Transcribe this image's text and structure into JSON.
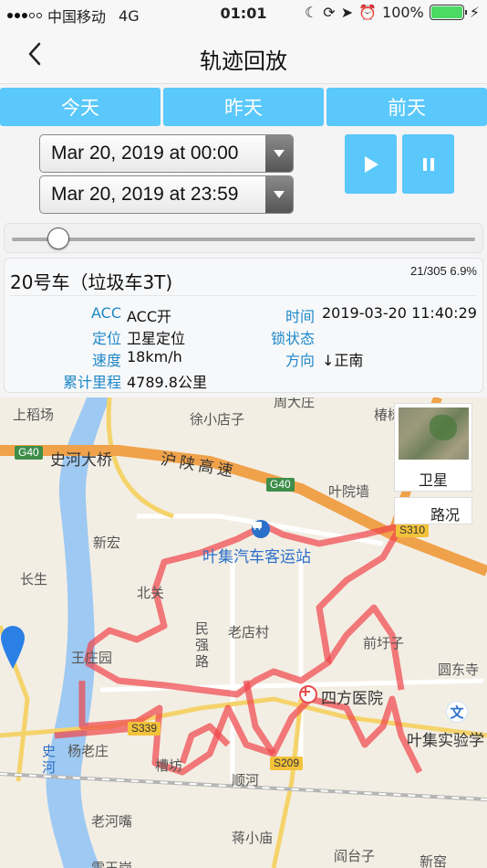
{
  "status_bar": {
    "carrier": "中国移动",
    "network": "4G",
    "time": "01:01",
    "battery": "100%",
    "battery_level": 1.0
  },
  "nav": {
    "title": "轨迹回放",
    "back_icon": "chevron-left-icon"
  },
  "day_tabs": [
    "今天",
    "昨天",
    "前天"
  ],
  "date_range": {
    "start": "Mar 20, 2019 at 00:00",
    "end": "Mar 20, 2019 at 23:59"
  },
  "controls": {
    "play_icon": "play-icon",
    "pause_icon": "pause-icon"
  },
  "slider": {
    "progress": 0.069
  },
  "vehicle": {
    "name": "20号车（垃圾车3T)",
    "progress_text": "21/305 6.9%",
    "acc_label": "ACC",
    "acc_value": "ACC开",
    "time_label": "时间",
    "time_value": "2019-03-20 11:40:29",
    "positioning_label": "定位",
    "positioning_value": "卫星定位",
    "lock_label": "锁状态",
    "lock_value": "",
    "speed_label": "速度",
    "speed_value": "18km/h",
    "direction_label": "方向",
    "direction_value": "↓正南",
    "mileage_label": "累计里程",
    "mileage_value": "4789.8公里"
  },
  "map": {
    "labels": {
      "shanghe_bridge": "史河大桥",
      "hushan_highway": "沪陕高速",
      "shangdaofang": "上稻场",
      "xuxiaodianzi": "徐小店子",
      "zhoulaozhuang": "周大庄",
      "chunshuzhuang": "椿树庄",
      "yeyuanqiang": "叶院墙",
      "xinhong": "新宏",
      "changsheng": "长生",
      "beiguan": "北关",
      "bus_station": "叶集汽车客运站",
      "minqiang_road": "民强路",
      "laodiancun": "老店村",
      "qianyuzi": "前圩子",
      "yuandongsi": "圆东寺",
      "wangzhuangyuan": "王庄园",
      "sifang_hospital": "四方医院",
      "yeji_school": "叶集实验学",
      "yangshuzhuang": "杨老庄",
      "caodian": "槽坊",
      "shunhe": "顺河",
      "shihe": "史河",
      "laohezui": "老河嘴",
      "jiangxiaomiao": "蒋小庙",
      "yantaizi": "阎台子",
      "xinyao": "新窑",
      "xuetugang": "雪王岗",
      "g40_a": "G40",
      "g40_b": "G40",
      "s310": "S310",
      "s339": "S339",
      "s209": "S209",
      "school_poi": "文"
    },
    "satellite_label": "卫星",
    "traffic_label": "路况",
    "pin_icon": "location-pin-icon",
    "bus_icon": "bus-station-icon",
    "hospital_icon": "hospital-icon"
  },
  "colors": {
    "accent": "#5ac8fa",
    "label_blue": "#1e88c8",
    "track_red": "#f0444a",
    "highway_orange": "#f5a94a"
  }
}
